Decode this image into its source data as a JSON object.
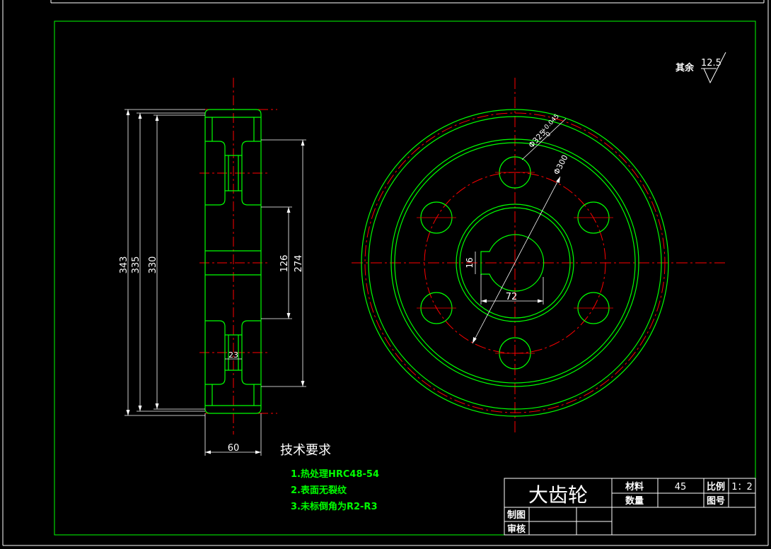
{
  "colors": {
    "background": "#000000",
    "outline": "#00ff00",
    "centerline": "#ff0000",
    "dimension": "#ffffff",
    "border": "#ffffff",
    "frame": "#00ff00",
    "note": "#00ff00"
  },
  "side_view": {
    "dims": {
      "d343": "343",
      "d335": "335",
      "d330": "330",
      "d274": "274",
      "d126": "126",
      "d60": "60",
      "d23": "23"
    }
  },
  "front_view": {
    "dims": {
      "od": "Φ325",
      "tol_upper": "+0.045",
      "tol_lower": "0",
      "pcd": "Φ300",
      "key": "16",
      "bore": "72"
    }
  },
  "roughness": {
    "label": "其余",
    "value": "12.5"
  },
  "tech_req": {
    "title": "技术要求",
    "items": [
      "1.热处理HRC48-54",
      "2.表面无裂纹",
      "3.未标倒角为R2-R3"
    ]
  },
  "title_block": {
    "part_name": "大齿轮",
    "material_label": "材料",
    "material_value": "45",
    "scale_label": "比例",
    "scale_value": "1：2",
    "quantity_label": "数量",
    "drawing_no_label": "图号",
    "drawn_label": "制图",
    "checked_label": "审核"
  }
}
